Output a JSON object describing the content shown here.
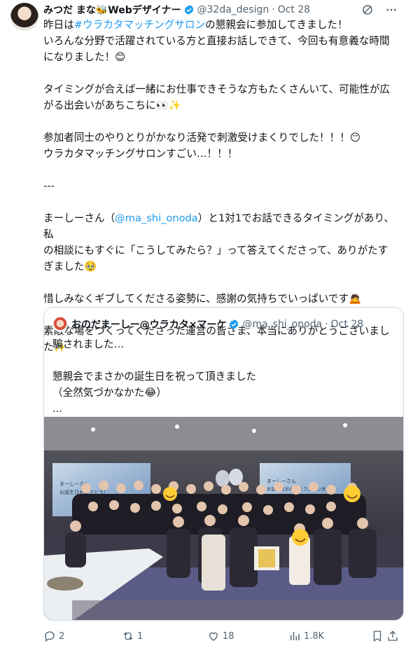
{
  "tweet": {
    "author_name": "みつだ まな🐝Webデザイナー",
    "handle": "@32da_design",
    "separator": "·",
    "date": "Oct 28",
    "lines": {
      "l1a": "昨日は",
      "l1_link": "#ウラカタマッチングサロン",
      "l1b": "の懇親会に参加してきました！",
      "l2": "いろんな分野で活躍されている方と直接お話しできて、今回も有意義な時間",
      "l3": "になりました！😊",
      "l4": "タイミングが合えば一緒にお仕事できそうな方もたくさんいて、可能性が広",
      "l5": "がる出会いがあちこちに👀✨",
      "l6": "参加者同士のやりとりがかなり活発で刺激受けまくりでした！！！😶",
      "l7": "ウラカタマッチングサロンすごい…！！！",
      "l8": "---",
      "l9a": "まーしーさん（",
      "l9_link": "@ma_shi_onoda",
      "l9b": "）と1対1でお話できるタイミングがあり、私",
      "l10": "の相談にもすぐに「こうしてみたら？」って答えてくださって、ありがたす",
      "l11": "ぎました🥹",
      "l12": "惜しみなくギブしてくださる姿勢に、感謝の気持ちでいっぱいです🙇",
      "l13": "素敵な場をつくってくださった運営の皆さま、本当にありがとうございまし",
      "l14": "た✨"
    }
  },
  "quote": {
    "author_name": "おのだまーしー@ウラカタ×マーケ",
    "handle": "@ma_shi_onoda",
    "separator": "·",
    "date": "Oct 28",
    "lines": [
      "騙されました…",
      "",
      "懇親会でまさかの誕生日を祝って頂きました",
      "（全然気づかなかた😂）",
      "..."
    ],
    "photo": {
      "screen_text_left": [
        "まーしーさん",
        "お誕生日おめでとう！"
      ],
      "screen_text_right": [
        "まーしーさん",
        "お誕生日おめでとうございます"
      ]
    }
  },
  "actions": {
    "replies": "2",
    "reposts": "1",
    "likes": "18",
    "views": "1.8K"
  },
  "colors": {
    "accent": "#1d9bf0",
    "muted": "#536471",
    "border": "#cfd9de"
  }
}
